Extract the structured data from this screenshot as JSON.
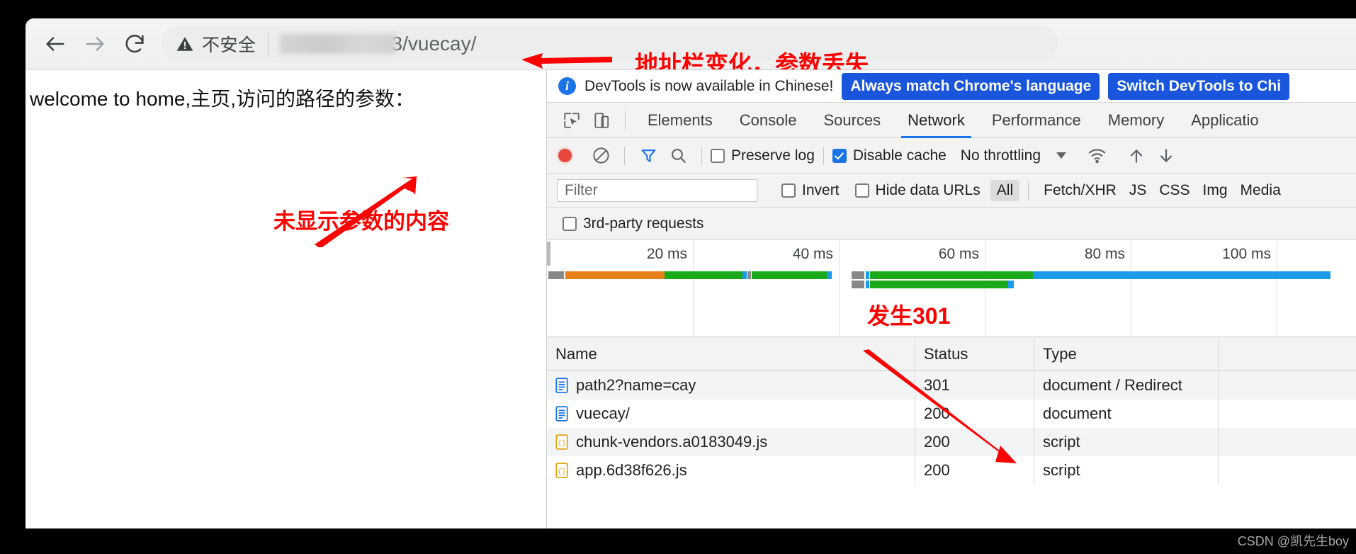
{
  "browser": {
    "nav": {
      "back_icon": "arrow-left-icon",
      "forward_icon": "arrow-right-icon",
      "reload_icon": "reload-icon"
    },
    "omnibox": {
      "warning_icon": "warning-triangle-icon",
      "security_label": "不安全",
      "url_visible_tail": "3/vuecay/",
      "url_redacted": true
    }
  },
  "annotations": {
    "address_bar": "地址栏变化，参数丢失",
    "missing_params": "未显示参数的内容",
    "redirect_301": "发生301",
    "color": "#fe0000"
  },
  "page": {
    "body_text": "welcome to home,主页,访问的路径的参数："
  },
  "devtools": {
    "banner": {
      "info_icon": "info-circle-icon",
      "message": "DevTools is now available in Chinese!",
      "primary_button": "Always match Chrome's language",
      "secondary_button": "Switch DevTools to Chi"
    },
    "toolbar_icons": {
      "inspect": "inspect-cursor-icon",
      "device": "device-toolbar-icon"
    },
    "tabs": [
      {
        "label": "Elements",
        "active": false
      },
      {
        "label": "Console",
        "active": false
      },
      {
        "label": "Sources",
        "active": false
      },
      {
        "label": "Network",
        "active": true
      },
      {
        "label": "Performance",
        "active": false
      },
      {
        "label": "Memory",
        "active": false
      },
      {
        "label": "Applicatio",
        "active": false
      }
    ],
    "network_toolbar": {
      "record_icon": "record-dot-icon",
      "clear_icon": "clear-circle-slash-icon",
      "filter_icon": "filter-funnel-icon",
      "search_icon": "search-magnifier-icon",
      "preserve_log": {
        "label": "Preserve log",
        "checked": false
      },
      "disable_cache": {
        "label": "Disable cache",
        "checked": true
      },
      "throttling": "No throttling",
      "throttle_caret_icon": "chevron-down-icon",
      "wifi_icon": "wifi-icon",
      "import_icon": "upload-arrow-icon",
      "export_icon": "download-arrow-icon"
    },
    "filter_bar": {
      "filter_placeholder": "Filter",
      "filter_value": "",
      "invert": {
        "label": "Invert",
        "checked": false
      },
      "hide_data_urls": {
        "label": "Hide data URLs",
        "checked": false
      },
      "types": [
        {
          "label": "All",
          "active": true
        },
        {
          "label": "Fetch/XHR",
          "active": false
        },
        {
          "label": "JS",
          "active": false
        },
        {
          "label": "CSS",
          "active": false
        },
        {
          "label": "Img",
          "active": false
        },
        {
          "label": "Media",
          "active": false
        }
      ],
      "third_party": {
        "label": "3rd-party requests",
        "checked": false
      }
    },
    "overview": {
      "ticks": [
        "20 ms",
        "40 ms",
        "60 ms",
        "80 ms",
        "100 ms"
      ],
      "bars": [
        {
          "start_pct": 0.0,
          "segments": [
            {
              "w_pct": 2.2,
              "color": "#888888"
            },
            {
              "w_pct": 17.8,
              "color": "#e8801a"
            },
            {
              "w_pct": 9.6,
              "color": "#1aa91a"
            },
            {
              "w_pct": 0.6,
              "color": "#1a9ae8"
            },
            {
              "w_pct": 0.5,
              "color": "#888888"
            },
            {
              "w_pct": 13.3,
              "color": "#1aa91a"
            },
            {
              "w_pct": 0.7,
              "color": "#1a9ae8"
            }
          ]
        },
        {
          "start_pct": 37.8,
          "segments": [
            {
              "w_pct": 1.7,
              "color": "#888888"
            },
            {
              "w_pct": 0.5,
              "color": "#1a9ae8"
            },
            {
              "w_pct": 22.6,
              "color": "#1aa91a"
            },
            {
              "w_pct": 37.4,
              "color": "#1a9ae8"
            }
          ]
        },
        {
          "start_pct": 37.8,
          "row": 2,
          "segments": [
            {
              "w_pct": 1.7,
              "color": "#888888"
            },
            {
              "w_pct": 0.5,
              "color": "#1a9ae8"
            },
            {
              "w_pct": 19.4,
              "color": "#1aa91a"
            },
            {
              "w_pct": 0.8,
              "color": "#1a9ae8"
            }
          ]
        }
      ]
    },
    "requests": {
      "columns": [
        "Name",
        "Status",
        "Type"
      ],
      "rows": [
        {
          "icon": "document-file-icon",
          "name": "path2?name=cay",
          "status": "301",
          "type": "document / Redirect"
        },
        {
          "icon": "document-file-icon",
          "name": "vuecay/",
          "status": "200",
          "type": "document"
        },
        {
          "icon": "script-file-icon",
          "name": "chunk-vendors.a0183049.js",
          "status": "200",
          "type": "script"
        },
        {
          "icon": "script-file-icon",
          "name": "app.6d38f626.js",
          "status": "200",
          "type": "script"
        }
      ]
    }
  },
  "watermark": "CSDN @凯先生boy"
}
